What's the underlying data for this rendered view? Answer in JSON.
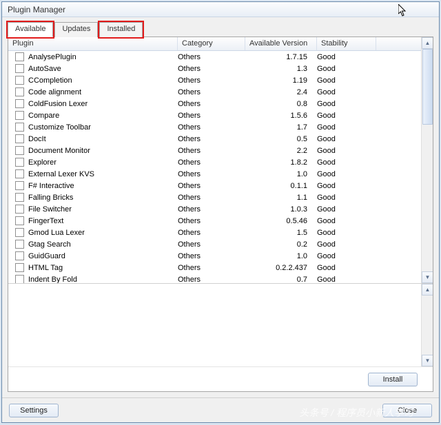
{
  "window": {
    "title": "Plugin Manager"
  },
  "tabs": [
    {
      "label": "Available",
      "active": true,
      "highlight": true
    },
    {
      "label": "Updates",
      "active": false,
      "highlight": false
    },
    {
      "label": "Installed",
      "active": false,
      "highlight": true
    }
  ],
  "columns": {
    "plugin": "Plugin",
    "category": "Category",
    "version": "Available Version",
    "stability": "Stability"
  },
  "plugins": [
    {
      "name": "AnalysePlugin",
      "category": "Others",
      "version": "1.7.15",
      "stability": "Good"
    },
    {
      "name": "AutoSave",
      "category": "Others",
      "version": "1.3",
      "stability": "Good"
    },
    {
      "name": "CCompletion",
      "category": "Others",
      "version": "1.19",
      "stability": "Good"
    },
    {
      "name": "Code alignment",
      "category": "Others",
      "version": "2.4",
      "stability": "Good"
    },
    {
      "name": "ColdFusion Lexer",
      "category": "Others",
      "version": "0.8",
      "stability": "Good"
    },
    {
      "name": "Compare",
      "category": "Others",
      "version": "1.5.6",
      "stability": "Good"
    },
    {
      "name": "Customize Toolbar",
      "category": "Others",
      "version": "1.7",
      "stability": "Good"
    },
    {
      "name": "DocIt",
      "category": "Others",
      "version": "0.5",
      "stability": "Good"
    },
    {
      "name": "Document Monitor",
      "category": "Others",
      "version": "2.2",
      "stability": "Good"
    },
    {
      "name": "Explorer",
      "category": "Others",
      "version": "1.8.2",
      "stability": "Good"
    },
    {
      "name": "External Lexer KVS",
      "category": "Others",
      "version": "1.0",
      "stability": "Good"
    },
    {
      "name": "F# Interactive",
      "category": "Others",
      "version": "0.1.1",
      "stability": "Good"
    },
    {
      "name": "Falling Bricks",
      "category": "Others",
      "version": "1.1",
      "stability": "Good"
    },
    {
      "name": "File Switcher",
      "category": "Others",
      "version": "1.0.3",
      "stability": "Good"
    },
    {
      "name": "FingerText",
      "category": "Others",
      "version": "0.5.46",
      "stability": "Good"
    },
    {
      "name": "Gmod Lua Lexer",
      "category": "Others",
      "version": "1.5",
      "stability": "Good"
    },
    {
      "name": "Gtag Search",
      "category": "Others",
      "version": "0.2",
      "stability": "Good"
    },
    {
      "name": "GuidGuard",
      "category": "Others",
      "version": "1.0",
      "stability": "Good"
    },
    {
      "name": "HTML Tag",
      "category": "Others",
      "version": "0.2.2.437",
      "stability": "Good"
    },
    {
      "name": "Indent By Fold",
      "category": "Others",
      "version": "0.7",
      "stability": "Good"
    }
  ],
  "buttons": {
    "install": "Install",
    "settings": "Settings",
    "close": "Close"
  },
  "watermark": "头条号 / 程序员小新人学习"
}
